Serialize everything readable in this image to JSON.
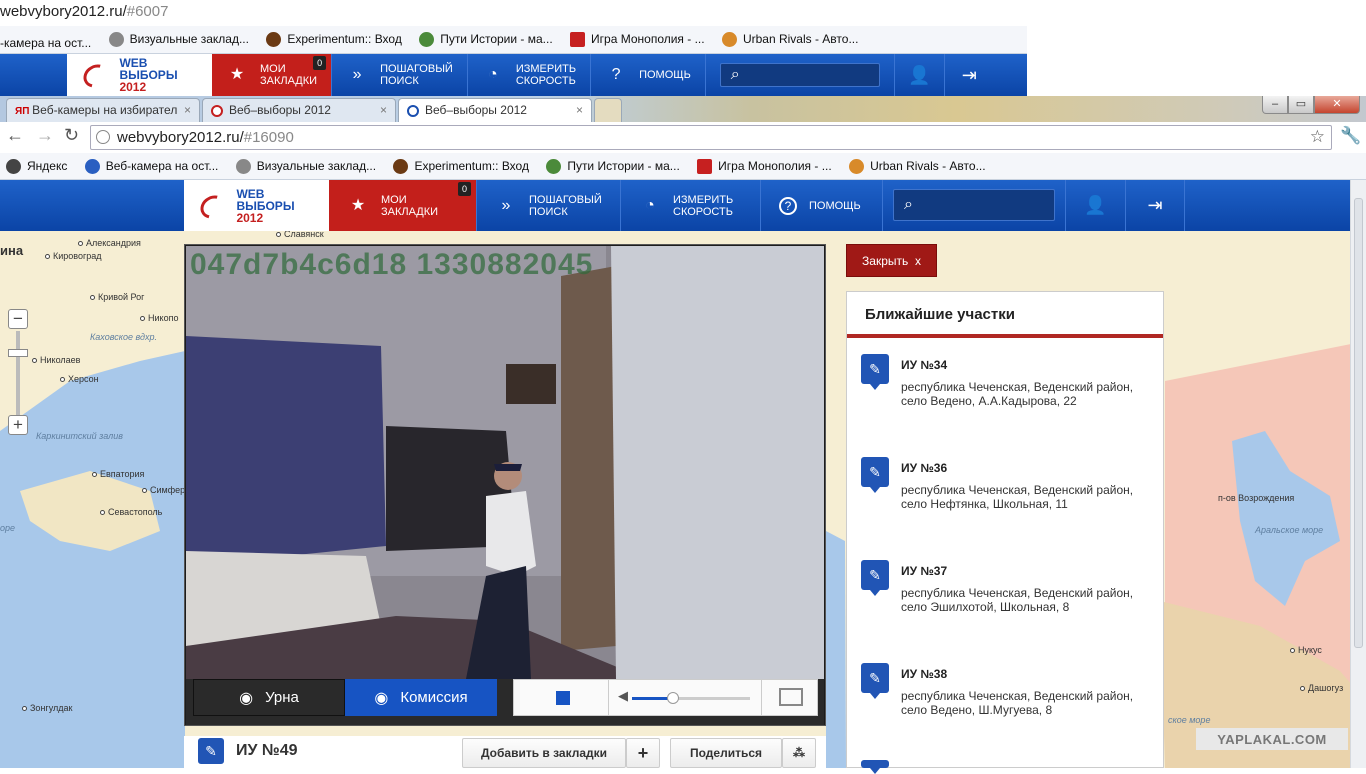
{
  "back_window": {
    "url_host": "webvybory2012.ru/",
    "url_hash": "#6007",
    "bookmarks": [
      "-камера на ост...",
      "Визуальные заклад...",
      "Experimentum:: Вход",
      "Пути Истории - ма...",
      "Игра Монополия - ...",
      "Urban Rivals - Авто..."
    ],
    "nav": {
      "logo_web": "WEB",
      "logo_vybory": "ВЫБОРЫ",
      "logo_year": "2012",
      "bookmarks_label_1": "МОИ",
      "bookmarks_label_2": "ЗАКЛАДКИ",
      "bookmarks_count": "0",
      "search_label_1": "ПОШАГОВЫЙ",
      "search_label_2": "ПОИСК",
      "speed_label_1": "ИЗМЕРИТЬ",
      "speed_label_2": "СКОРОСТЬ",
      "help_label": "ПОМОЩЬ"
    }
  },
  "tabs": [
    {
      "label": "Веб-камеры на избирател"
    },
    {
      "label": "Веб–выборы 2012"
    },
    {
      "label": "Веб–выборы 2012"
    }
  ],
  "window_controls": {
    "minimize": "–",
    "maximize": "▭",
    "close": "✕"
  },
  "toolbar": {
    "url_host": "webvybory2012.ru/",
    "url_hash": "#16090"
  },
  "bookmarks": [
    "Яндекс",
    "Веб-камера на ост...",
    "Визуальные заклад...",
    "Experimentum:: Вход",
    "Пути Истории - ма...",
    "Игра Монополия - ...",
    "Urban Rivals - Авто..."
  ],
  "nav": {
    "logo_web": "WEB",
    "logo_vybory": "ВЫБОРЫ",
    "logo_year": "2012",
    "bookmarks_label_1": "МОИ",
    "bookmarks_label_2": "ЗАКЛАДКИ",
    "bookmarks_count": "0",
    "search_label_1": "ПОШАГОВЫЙ",
    "search_label_2": "ПОИСК",
    "speed_label_1": "ИЗМЕРИТЬ",
    "speed_label_2": "СКОРОСТЬ",
    "help_label": "ПОМОЩЬ"
  },
  "map": {
    "labels": {
      "ina": "ина",
      "aleksandriya": "Александрия",
      "kirovograd": "Кировоград",
      "krivoy_rog": "Кривой Рог",
      "nikopol": "Никопо",
      "kakhovskoe": "Каховское вдхр.",
      "nikolaev": "Николаев",
      "kherson": "Херсон",
      "karkinitsky": "Каркинитский залив",
      "evpatoriya": "Евпатория",
      "simferopol": "Симферопо",
      "sevastopol": "Севастополь",
      "more": "оре",
      "slavyansk": "Славянск",
      "zongul": "Зонгулдак",
      "aral_sea": "Аральское море",
      "vozrozhdeniya": "п-ов Возрождения",
      "nukus": "Нукус",
      "dashoguz": "Дашогуз",
      "more_right": "ское море"
    }
  },
  "video": {
    "overlay_code": "047d7b4c6d18 1330882045"
  },
  "player_controls": {
    "urna_label": "Урна",
    "komissiya_label": "Комиссия",
    "volume_level": 0.35
  },
  "close_button": {
    "label": "Закрыть",
    "x": "x"
  },
  "panel": {
    "title": "Ближайшие участки",
    "items": [
      {
        "title": "ИУ №34",
        "address": "республика Чеченская, Веденский район, село Ведено, А.А.Кадырова, 22"
      },
      {
        "title": "ИУ №36",
        "address": "республика Чеченская, Веденский район, село Нефтянка, Школьная, 11"
      },
      {
        "title": "ИУ №37",
        "address": "республика Чеченская, Веденский район, село Эшилхотой, Школьная, 8"
      },
      {
        "title": "ИУ №38",
        "address": "республика Чеченская, Веденский район, село Ведено, Ш.Мугуева, 8"
      }
    ]
  },
  "station": {
    "title": "ИУ №49",
    "add_bookmark": "Добавить в закладки",
    "add_plus": "+",
    "share": "Поделиться"
  },
  "watermark": "YAPLAKAL.COM",
  "colors": {
    "nav_blue": "#0b44a6",
    "accent_red": "#c31f1b",
    "panel_red": "#b02723"
  }
}
